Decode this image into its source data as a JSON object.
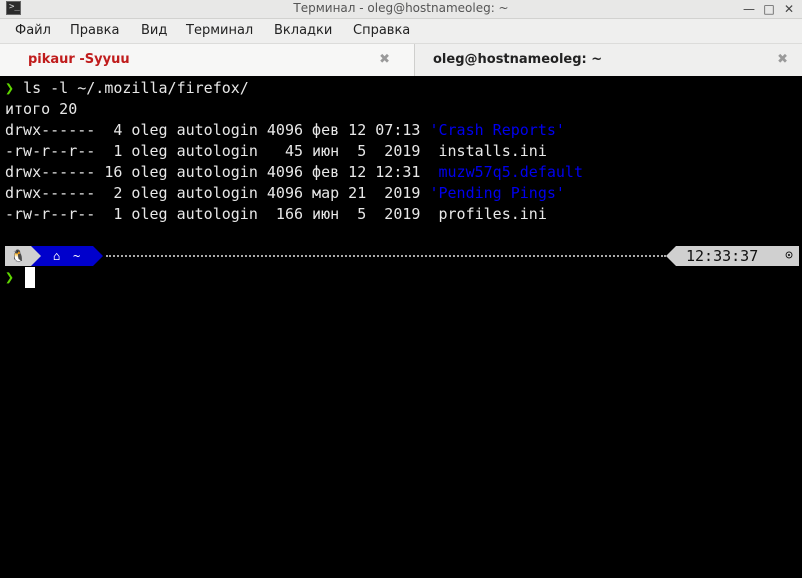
{
  "window": {
    "title": "Терминал - oleg@hostnameoleg: ~",
    "app_icon": ">_",
    "controls": {
      "minimize": "—",
      "maximize": "□",
      "close": "✕"
    }
  },
  "menu": [
    "Файл",
    "Правка",
    "Вид",
    "Терминал",
    "Вкладки",
    "Справка"
  ],
  "tabs": [
    {
      "label": "pikaur -Syyuu",
      "color": "#c01c1c",
      "close": "✖"
    },
    {
      "label": "oleg@hostnameoleg: ~",
      "close": "✖"
    }
  ],
  "terminal": {
    "prompt_symbol": "❯",
    "command": "ls -l ~/.mozilla/firefox/",
    "total": "итого 20",
    "entries": [
      {
        "meta": "drwx------  4 oleg autologin 4096 фев 12 07:13 ",
        "name": "'Crash Reports'",
        "is_dir": true
      },
      {
        "meta": "-rw-r--r--  1 oleg autologin   45 июн  5  2019 ",
        "name": " installs.ini",
        "is_dir": false
      },
      {
        "meta": "drwx------ 16 oleg autologin 4096 фев 12 12:31 ",
        "name": " muzw57q5.default",
        "is_dir": true
      },
      {
        "meta": "drwx------  2 oleg autologin 4096 мар 21  2019 ",
        "name": "'Pending Pings'",
        "is_dir": true
      },
      {
        "meta": "-rw-r--r--  1 oleg autologin  166 июн  5  2019 ",
        "name": " profiles.ini",
        "is_dir": false
      }
    ],
    "powerline": {
      "os_icon": "🐧",
      "dir_icon": "⌂",
      "dir": "~",
      "time": "12:33:37",
      "clock_icon": "⊙"
    },
    "colors": {
      "dir": "#0000ee",
      "prompt": "#5fd700",
      "segment_dir": "#0000cc"
    }
  }
}
